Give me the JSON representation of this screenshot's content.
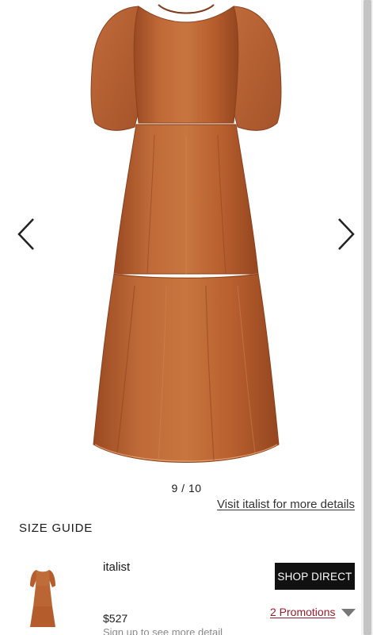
{
  "gallery": {
    "counter": "9 / 10",
    "visit_link": "Visit italist for more details"
  },
  "icons": {
    "prev": "chevron-left-icon",
    "next": "chevron-right-icon",
    "promo_toggle": "caret-down-icon"
  },
  "size_guide": "SIZE GUIDE",
  "offer": {
    "retailer": "italist",
    "button_label": "SHOP DIRECT",
    "price": "$527",
    "promotions": "2 Promotions",
    "signup_note": "Sign up to see more detail"
  },
  "colors": {
    "dress": "#b8602f",
    "button_bg": "#111111",
    "promo_text": "#9b1c2c"
  }
}
